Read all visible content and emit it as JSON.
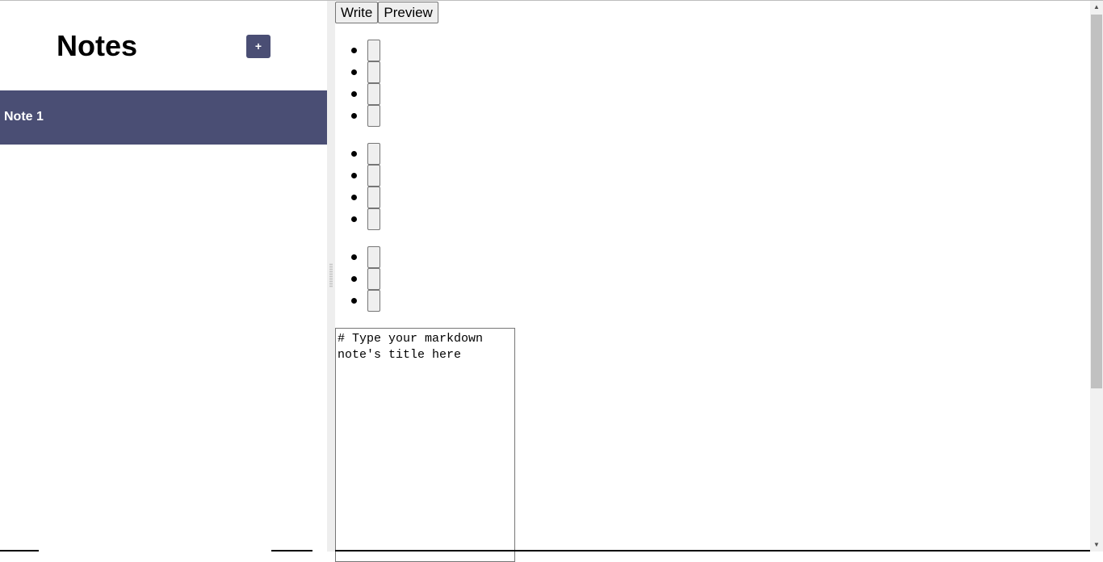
{
  "sidebar": {
    "title": "Notes",
    "add_button_label": "+",
    "notes": [
      {
        "label": "Note 1",
        "selected": true
      }
    ]
  },
  "editor": {
    "tabs": [
      {
        "label": "Write"
      },
      {
        "label": "Preview"
      }
    ],
    "toolbar_groups": [
      {
        "buttons": 4
      },
      {
        "buttons": 4
      },
      {
        "buttons": 3
      }
    ],
    "textarea_value": "# Type your markdown note's title here"
  },
  "scrollbar": {
    "up_arrow": "▲",
    "down_arrow": "▼"
  },
  "colors": {
    "accent": "#4a4e74",
    "gutter": "#eeeeee",
    "button_bg": "#efefef",
    "button_border": "#767676"
  },
  "icons": {
    "add": "plus-icon",
    "scroll_up": "up-arrow-icon",
    "scroll_down": "down-arrow-icon"
  }
}
